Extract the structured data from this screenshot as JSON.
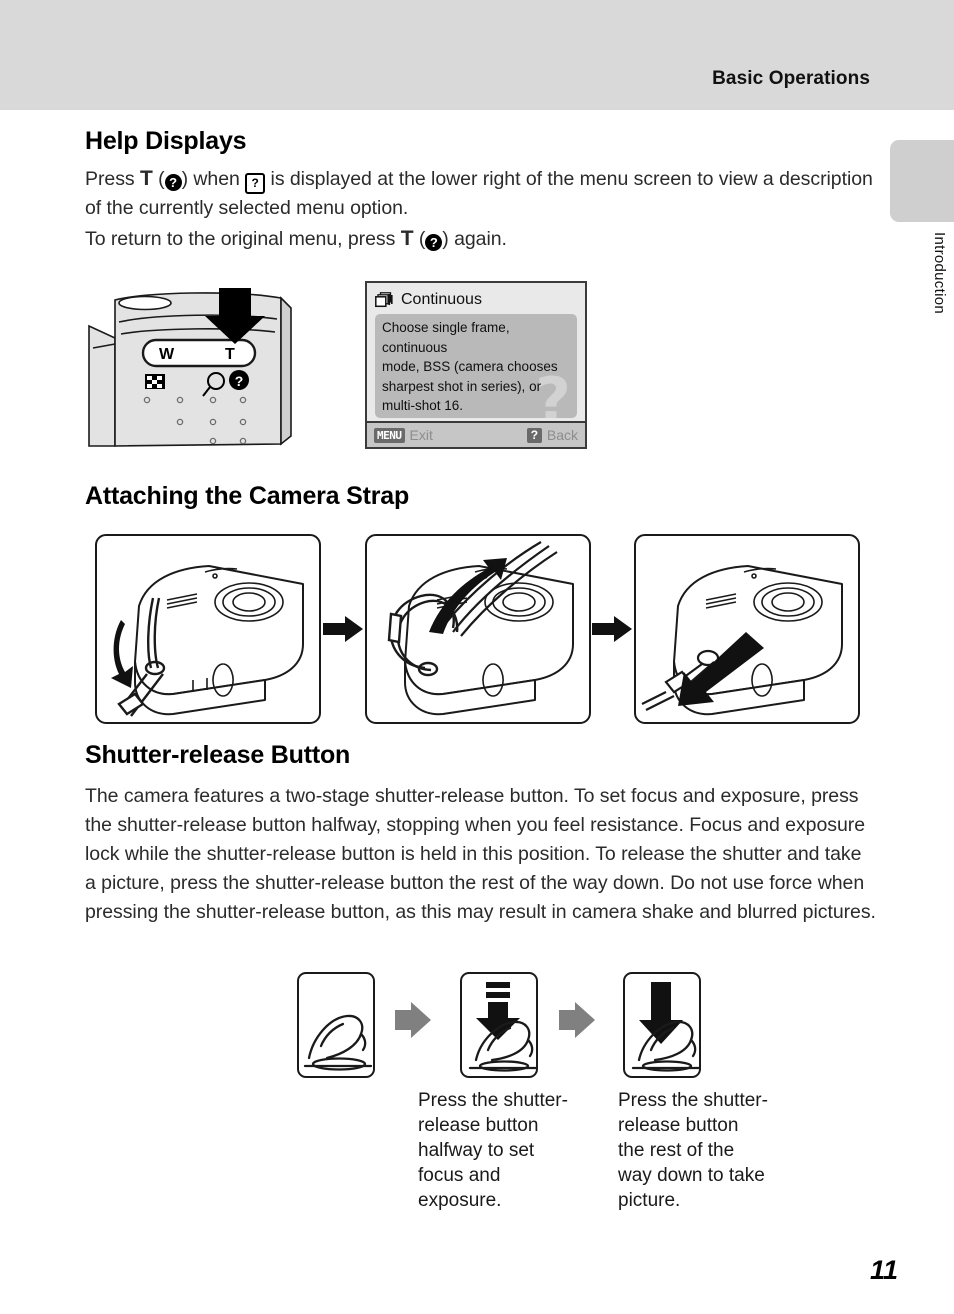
{
  "header": {
    "title": "Basic Operations",
    "tab_label": "Introduction",
    "band_color": "#d9d9d9",
    "tab_color": "#cfcfcf"
  },
  "sections": {
    "help_displays": {
      "heading": "Help Displays",
      "para1_a": "Press ",
      "para1_t": "T",
      "para1_b": " (",
      "para1_icon1": "?",
      "para1_c": ") when ",
      "para1_icon2": "?",
      "para1_d": " is displayed at the lower right of the menu screen to view a description of the currently selected menu option.",
      "para2_a": "To return to the original menu, press ",
      "para2_t": "T",
      "para2_b": " (",
      "para2_icon": "?",
      "para2_c": ") again."
    },
    "strap": {
      "heading": "Attaching the Camera Strap"
    },
    "shutter": {
      "heading": "Shutter-release Button",
      "body": "The camera features a two-stage shutter-release button. To set focus and exposure, press the shutter-release button halfway, stopping when you feel resistance. Focus and exposure lock while the shutter-release button is held in this position. To release the shutter and take a picture, press the shutter-release button the rest of the way down. Do not use force when pressing the shutter-release button, as this may result in camera shake and blurred pictures.",
      "caption_halfway": "Press the shutter-\nrelease button\nhalfway to set\nfocus and\nexposure.",
      "caption_full": "Press the shutter-\nrelease button\nthe rest of the\nway down to take\npicture."
    }
  },
  "camera_zoom_figure": {
    "wide_label": "W",
    "tele_label": "T"
  },
  "menu_screen": {
    "title": "Continuous",
    "description": "Choose single frame, continuous\nmode, BSS (camera chooses\nsharpest shot in series), or\nmulti-shot 16.",
    "watermark": "?",
    "footer_menu_badge": "MENU",
    "footer_menu_label": "Exit",
    "footer_back_badge": "?",
    "footer_back_label": "Back",
    "bg_color": "#e9e9e9",
    "body_bg_color": "#b9b9b9",
    "footer_bg_color": "#c6c6c6"
  },
  "page": {
    "number": "11"
  }
}
